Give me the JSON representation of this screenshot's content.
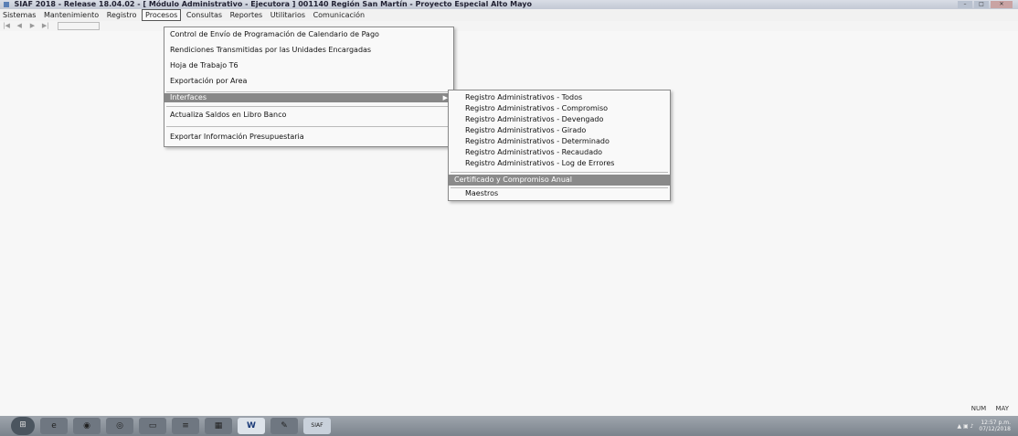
{
  "window": {
    "title": "SIAF 2018 - Release 18.04.02 - [ Módulo Administrativo - Ejecutora ] 001140 Región San Martín - Proyecto Especial Alto Mayo",
    "controls": [
      "–",
      "□",
      "✕"
    ]
  },
  "menubar": {
    "items": [
      "Sistemas",
      "Mantenimiento",
      "Registro",
      "Procesos",
      "Consultas",
      "Reportes",
      "Utilitarios",
      "Comunicación"
    ],
    "active": "Procesos"
  },
  "toolbar": {
    "nav": [
      "|◀",
      "◀",
      "▶",
      "▶|"
    ]
  },
  "procesos_menu": {
    "items": [
      "Control de Envío de Programación de Calendario de Pago",
      "Rendiciones Transmitidas por las Unidades Encargadas",
      "Hoja de Trabajo T6",
      "Exportación por Area",
      "Interfaces",
      "Actualiza Saldos en Libro Banco",
      "Exportar Información Presupuestaria"
    ],
    "submenu_arrow": "▶"
  },
  "interfaces_submenu": {
    "items": [
      "Registro Administrativos - Todos",
      "Registro Administrativos - Compromiso",
      "Registro Administrativos - Devengado",
      "Registro Administrativos - Girado",
      "Registro Administrativos - Determinado",
      "Registro Administrativos - Recaudado",
      "Registro Administrativos - Log de Errores",
      "Certificado y Compromiso Anual",
      "Maestros"
    ]
  },
  "statusbar": {
    "num": "NUM",
    "may": "MAY"
  },
  "taskbar": {
    "start_icon": "windows-start-icon",
    "buttons": [
      "ie-icon",
      "firefox-icon",
      "chrome-icon",
      "explorer-icon",
      "media-icon",
      "calculator-icon",
      "word-icon",
      "pen-icon",
      "siaf-icon"
    ],
    "word_label": "W",
    "siaf_label": "SIAF",
    "clock_time": "12:57 p.m.",
    "clock_date": "07/12/2018"
  }
}
